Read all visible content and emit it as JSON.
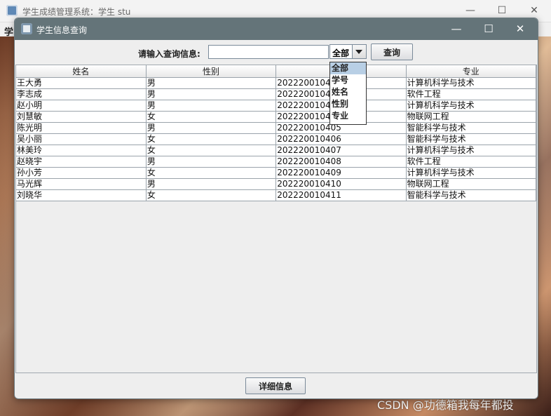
{
  "outer_window": {
    "title": "学生成绩管理系统：学生 stu",
    "menu_glyph": "学",
    "controls": {
      "minimize": "—",
      "maximize": "☐",
      "close": "✕"
    }
  },
  "dialog": {
    "title": "学生信息查询",
    "controls": {
      "minimize": "—",
      "maximize": "☐",
      "close": "✕"
    }
  },
  "search": {
    "label": "请输入查询信息:",
    "input_value": "",
    "combo_selected": "全部",
    "combo_options": [
      "全部",
      "学号",
      "姓名",
      "性别",
      "专业"
    ],
    "query_button": "查询"
  },
  "table": {
    "columns": [
      "姓名",
      "性别",
      "",
      "专业"
    ],
    "rows": [
      [
        "王大勇",
        "男",
        "20222001040",
        "计算机科学与技术"
      ],
      [
        "李志成",
        "男",
        "20222001040",
        "软件工程"
      ],
      [
        "赵小明",
        "男",
        "20222001040",
        "计算机科学与技术"
      ],
      [
        "刘慧敏",
        "女",
        "20222001040",
        "物联网工程"
      ],
      [
        "陈光明",
        "男",
        "202220010405",
        "智能科学与技术"
      ],
      [
        "吴小丽",
        "女",
        "202220010406",
        "智能科学与技术"
      ],
      [
        "林美玲",
        "女",
        "202220010407",
        "计算机科学与技术"
      ],
      [
        "赵晓宇",
        "男",
        "202220010408",
        "软件工程"
      ],
      [
        "孙小芳",
        "女",
        "202220010409",
        "计算机科学与技术"
      ],
      [
        "马光辉",
        "男",
        "202220010410",
        "物联网工程"
      ],
      [
        "刘晓华",
        "女",
        "202220010411",
        "智能科学与技术"
      ]
    ]
  },
  "detail_button": "详细信息",
  "watermark": "CSDN @功德箱我每年都投"
}
